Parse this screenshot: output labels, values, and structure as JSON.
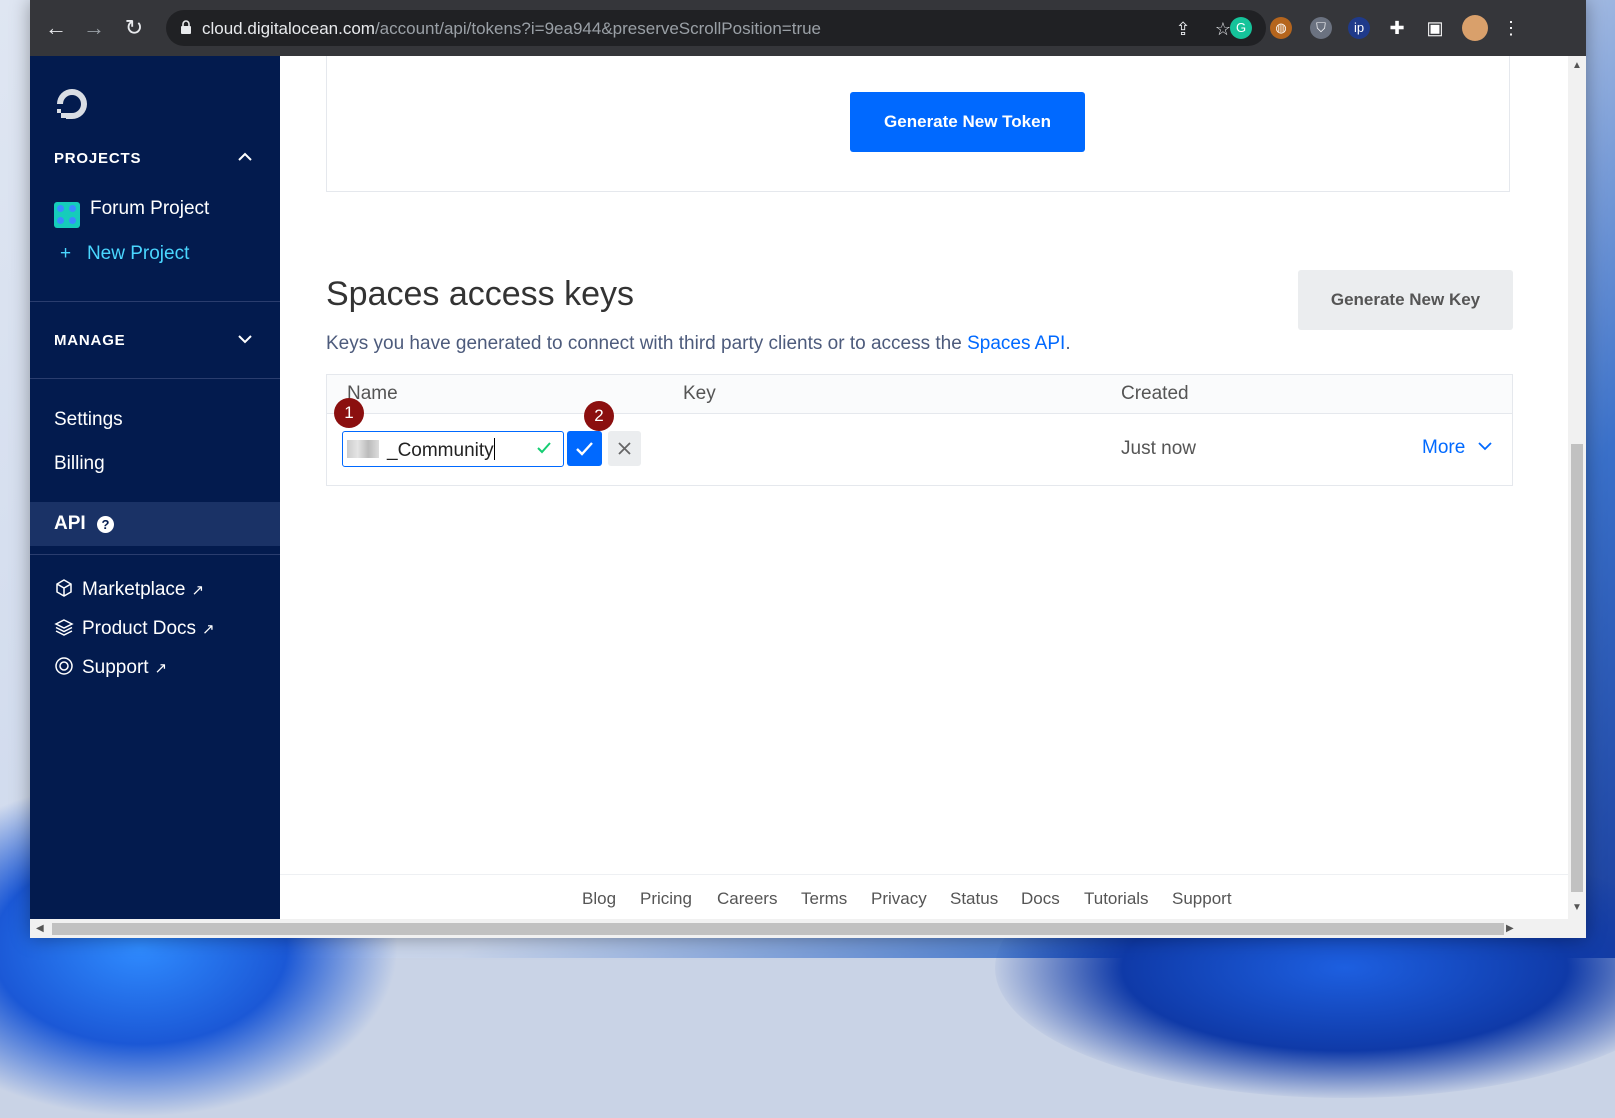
{
  "browser": {
    "url_host": "cloud.digitalocean.com",
    "url_path": "/account/api/tokens?i=9ea944&preserveScrollPosition=true"
  },
  "sidebar": {
    "projects_heading": "PROJECTS",
    "project_name": "Forum Project",
    "new_project": "New Project",
    "new_project_plus": "+",
    "manage_heading": "MANAGE",
    "nav": {
      "settings": "Settings",
      "billing": "Billing",
      "api": "API",
      "api_help": "?"
    },
    "external": {
      "marketplace": "Marketplace",
      "product_docs": "Product Docs",
      "support": "Support",
      "arrow": "↗"
    }
  },
  "tokens": {
    "generate_button": "Generate New Token"
  },
  "spaces": {
    "title": "Spaces access keys",
    "generate_key_button": "Generate New Key",
    "description": "Keys you have generated to connect with third party clients or to access the ",
    "description_link": "Spaces API",
    "description_end": ".",
    "columns": {
      "name": "Name",
      "key": "Key",
      "created": "Created"
    },
    "row": {
      "name_value": "_Community",
      "created": "Just now",
      "more": "More"
    }
  },
  "annotations": {
    "step1": "1",
    "step2": "2"
  },
  "footer": {
    "links": [
      "Blog",
      "Pricing",
      "Careers",
      "Terms",
      "Privacy",
      "Status",
      "Docs",
      "Tutorials",
      "Support"
    ]
  },
  "colors": {
    "sidebar_bg": "#031b4e",
    "primary_blue": "#0069ff",
    "annotation_red": "#8b0f0f",
    "link_cyan": "#4ad6ff"
  }
}
